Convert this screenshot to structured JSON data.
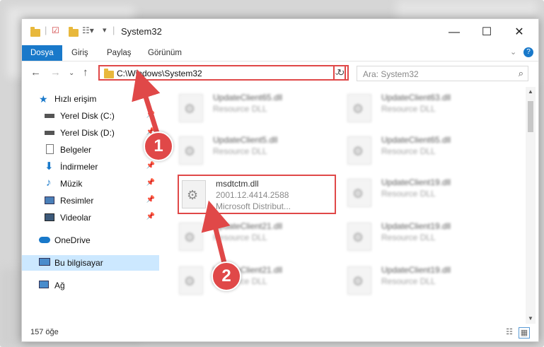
{
  "window": {
    "title": "System32",
    "controls": {
      "minimize": "—",
      "maximize": "☐",
      "close": "✕"
    }
  },
  "ribbon": {
    "tabs": [
      "Dosya",
      "Giriş",
      "Paylaş",
      "Görünüm"
    ]
  },
  "nav": {
    "address": "C:\\Windows\\System32",
    "search_placeholder": "Ara: System32"
  },
  "sidebar": {
    "items": [
      {
        "label": "Hızlı erişim",
        "icon": "star-icon"
      },
      {
        "label": "Yerel Disk (C:)",
        "icon": "drive-icon"
      },
      {
        "label": "Yerel Disk (D:)",
        "icon": "drive-icon"
      },
      {
        "label": "Belgeler",
        "icon": "documents-icon"
      },
      {
        "label": "İndirmeler",
        "icon": "downloads-icon"
      },
      {
        "label": "Müzik",
        "icon": "music-icon"
      },
      {
        "label": "Resimler",
        "icon": "pictures-icon"
      },
      {
        "label": "Videolar",
        "icon": "videos-icon"
      },
      {
        "label": "OneDrive",
        "icon": "cloud-icon"
      },
      {
        "label": "Bu bilgisayar",
        "icon": "computer-icon"
      },
      {
        "label": "Ağ",
        "icon": "network-icon"
      }
    ]
  },
  "files": [
    {
      "name": "UpdateClient65.dll",
      "desc": "Resource DLL"
    },
    {
      "name": "UpdateClient63.dll",
      "desc": "Resource DLL"
    },
    {
      "name": "UpdateClient5.dll",
      "desc": "Resource DLL"
    },
    {
      "name": "UpdateClient65.dll",
      "desc": "Resource DLL"
    },
    {
      "name": "msdtctm.dll",
      "version": "2001.12.4414.2588",
      "desc": "Microsoft Distribut..."
    },
    {
      "name": "UpdateClient19.dll",
      "desc": "Resource DLL"
    },
    {
      "name": "UpdateClient21.dll",
      "desc": "Resource DLL"
    },
    {
      "name": "UpdateClient19.dll",
      "desc": "Resource DLL"
    },
    {
      "name": "UpdateClient21.dll",
      "desc": "Resource DLL"
    },
    {
      "name": "UpdateClient19.dll",
      "desc": "Resource DLL"
    }
  ],
  "status": {
    "count": "157 öğe"
  },
  "annotations": {
    "step1": "1",
    "step2": "2"
  },
  "colors": {
    "accent": "#1979ca",
    "highlight": "#e04848",
    "selected": "#cce8ff"
  }
}
